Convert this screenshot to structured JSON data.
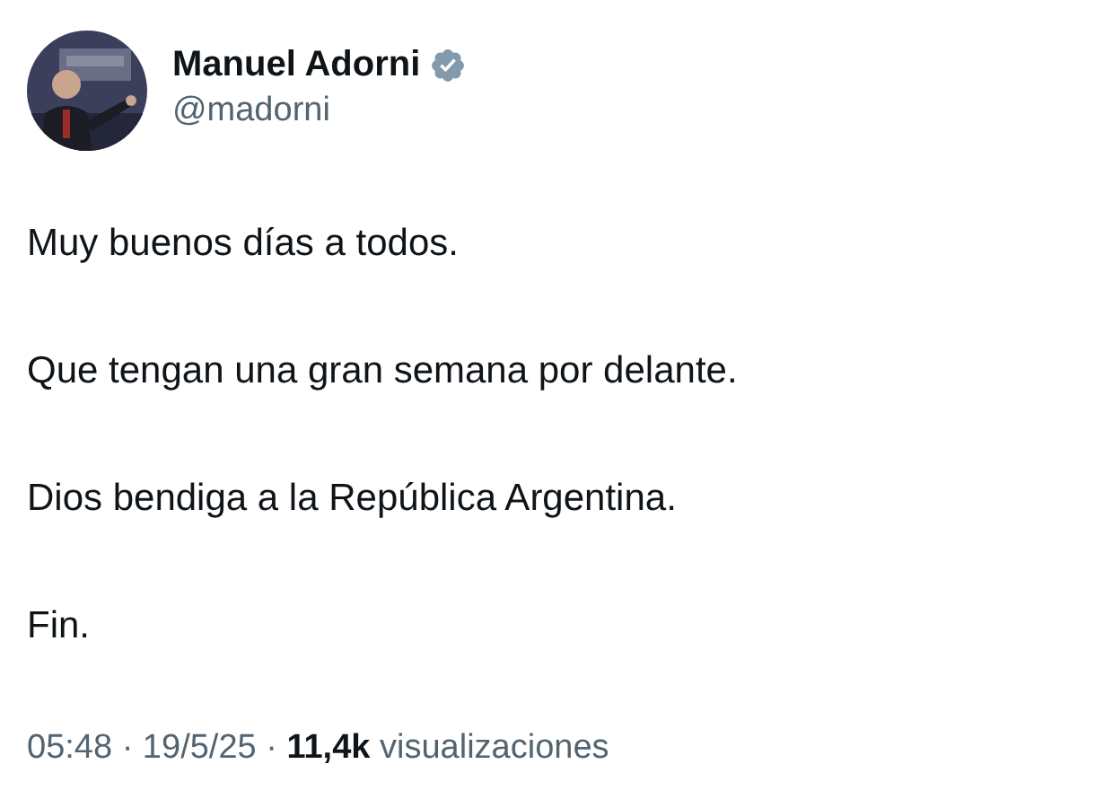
{
  "author": {
    "name": "Manuel Adorni",
    "handle": "@madorni",
    "verified": true
  },
  "paragraphs": [
    "Muy buenos días a todos.",
    "Que tengan una gran semana por delante.",
    "Dios bendiga a la República Argentina.",
    "Fin."
  ],
  "footer": "05:48 · 19/5/25 · **11,4k** visualizaciones"
}
